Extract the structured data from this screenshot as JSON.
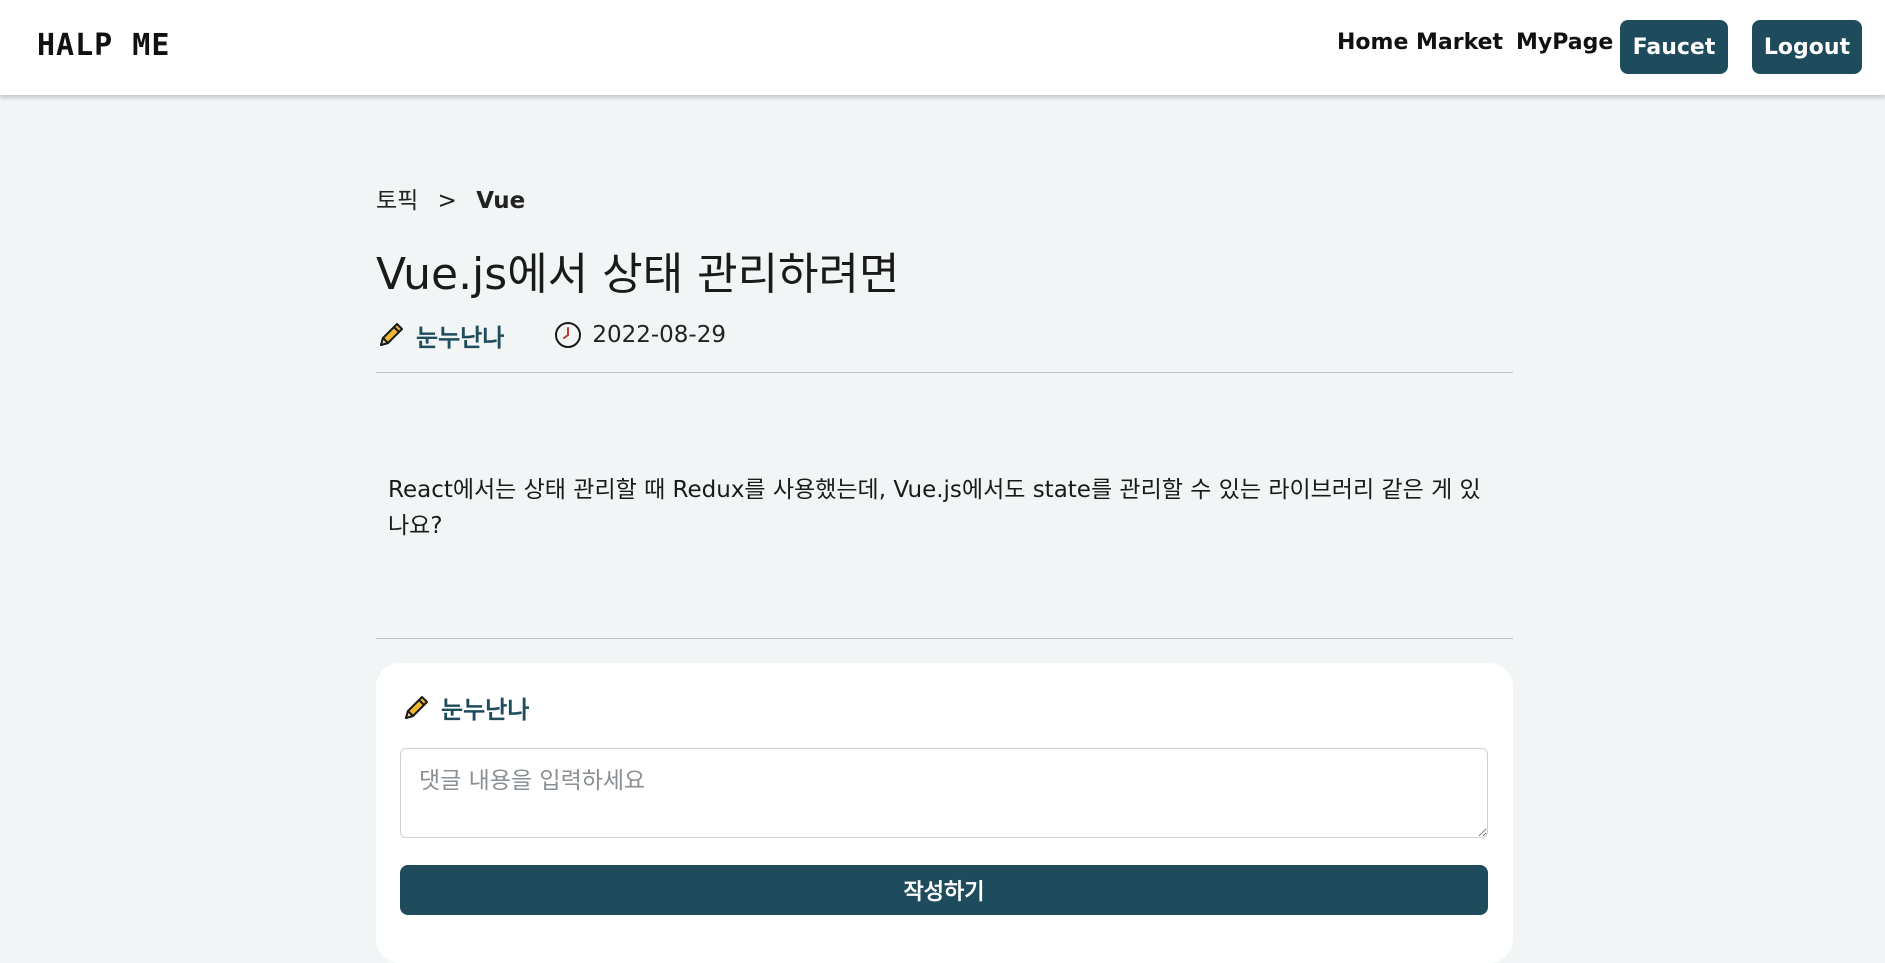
{
  "nav": {
    "logo": "HALP ME",
    "links": [
      "Home",
      "Market",
      "MyPage"
    ],
    "faucet_label": "Faucet",
    "logout_label": "Logout"
  },
  "post": {
    "breadcrumb_root": "토픽",
    "breadcrumb_sep": ">",
    "breadcrumb_current": "Vue",
    "title": "Vue.js에서 상태 관리하려면",
    "author": "눈누난나",
    "date": "2022-08-29",
    "body": "React에서는 상태 관리할 때 Redux를 사용했는데, Vue.js에서도 state를 관리할 수 있는 라이브러리 같은 게 있나요?"
  },
  "comment_form": {
    "author": "눈누난나",
    "placeholder": "댓글 내용을 입력하세요",
    "submit_label": "작성하기"
  },
  "colors": {
    "accent": "#1f4c5c",
    "background": "#f2f5f6",
    "pencil": "#f2b632"
  },
  "icons": {
    "author": "pencil-icon",
    "date": "clock-icon"
  }
}
